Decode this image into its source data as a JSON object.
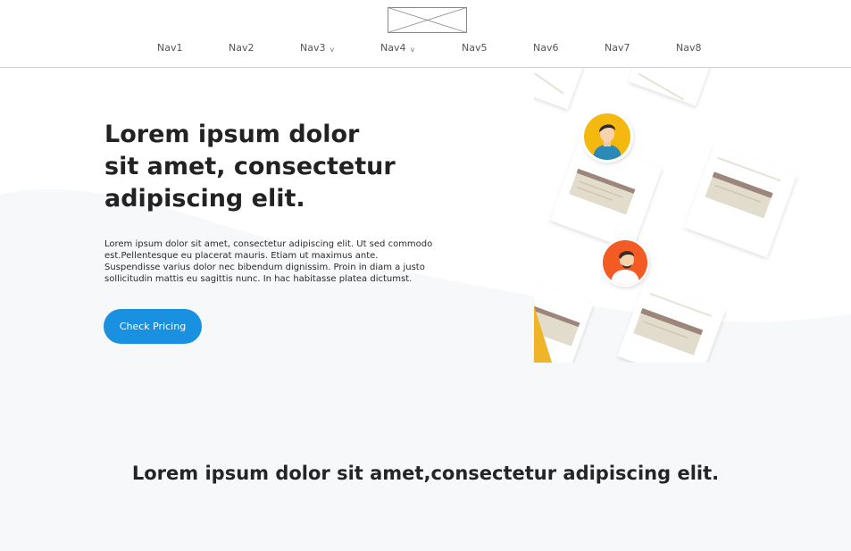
{
  "header": {
    "logo_alt": "logo placeholder",
    "nav": [
      {
        "label": "Nav1",
        "dropdown": false
      },
      {
        "label": "Nav2",
        "dropdown": false
      },
      {
        "label": "Nav3",
        "dropdown": true
      },
      {
        "label": "Nav4",
        "dropdown": true
      },
      {
        "label": "Nav5",
        "dropdown": false
      },
      {
        "label": "Nav6",
        "dropdown": false
      },
      {
        "label": "Nav7",
        "dropdown": false
      },
      {
        "label": "Nav8",
        "dropdown": false
      }
    ],
    "caret_glyph": "v"
  },
  "hero": {
    "title": "Lorem ipsum dolor sit amet, consectetur adipiscing elit.",
    "body": "Lorem ipsum dolor sit amet, consectetur adipiscing elit. Ut sed commodo est.Pellentesque eu placerat mauris. Etiam ut maximus ante. Suspendisse varius dolor nec bibendum dignissim. Proin in diam a justo sollicitudin mattis eu sagittis nunc. In hac habitasse platea dictumst.",
    "cta_label": "Check Pricing"
  },
  "section": {
    "title": "Lorem ipsum dolor sit amet,consectetur adipiscing elit."
  },
  "colors": {
    "accent": "#1a90e0",
    "avatar_yellow": "#f5b80f",
    "avatar_orange": "#f45a23",
    "background_wave": "#f7f8fa"
  }
}
